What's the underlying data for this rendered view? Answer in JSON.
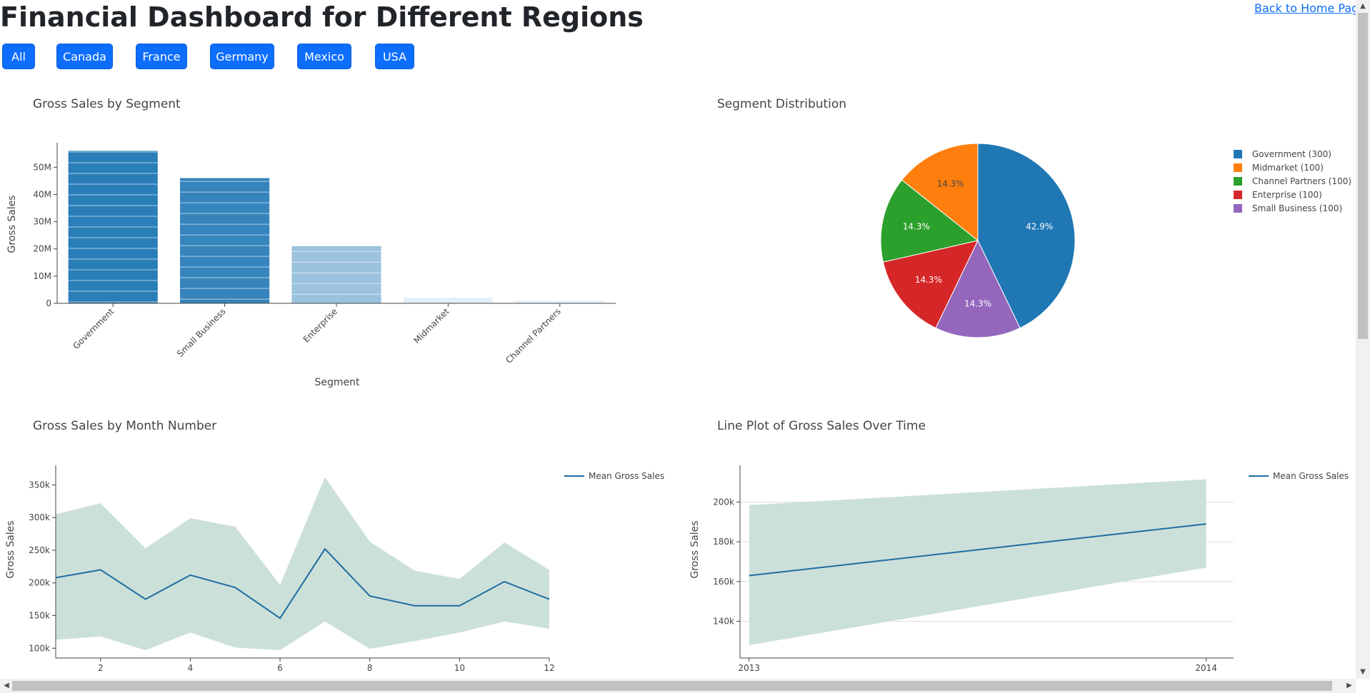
{
  "header": {
    "title": "Financial Dashboard for Different Regions",
    "home_link": "Back to Home Page"
  },
  "filters": [
    "All",
    "Canada",
    "France",
    "Germany",
    "Mexico",
    "USA"
  ],
  "colors": {
    "button": "#0d6efd",
    "bar": "#1f77b4",
    "band": "#cce0da",
    "line": "#1f6da0",
    "pie": [
      "#1f77b4",
      "#9467bd",
      "#d62728",
      "#2ca02c",
      "#ff7f0e"
    ]
  },
  "chart_data": [
    {
      "type": "bar",
      "title": "Gross Sales by Segment",
      "xlabel": "Segment",
      "ylabel": "Gross Sales",
      "categories": [
        "Government",
        "Small Business",
        "Enterprise",
        "Midmarket",
        "Channel Partners"
      ],
      "values": [
        56000000,
        46000000,
        21000000,
        2000000,
        1000000
      ],
      "ylim": [
        0,
        59000000
      ],
      "yticks": [
        0,
        10000000,
        20000000,
        30000000,
        40000000,
        50000000
      ],
      "ytick_labels": [
        "0",
        "10M",
        "20M",
        "30M",
        "40M",
        "50M"
      ]
    },
    {
      "type": "pie",
      "title": "Segment Distribution",
      "slices": [
        {
          "name": "Government (300)",
          "value": 300,
          "label": "42.9%"
        },
        {
          "name": "Small Business (100)",
          "value": 100,
          "label": "14.3%"
        },
        {
          "name": "Enterprise (100)",
          "value": 100,
          "label": "14.3%"
        },
        {
          "name": "Channel Partners (100)",
          "value": 100,
          "label": "14.3%"
        },
        {
          "name": "Midmarket (100)",
          "value": 100,
          "label": "14.3%"
        }
      ],
      "legend": [
        "Government (300)",
        "Midmarket (100)",
        "Channel Partners (100)",
        "Enterprise (100)",
        "Small Business (100)"
      ],
      "legend_placement": "right"
    },
    {
      "type": "area",
      "title": "Gross Sales by Month Number",
      "ylabel": "Gross Sales",
      "x": [
        1,
        2,
        3,
        4,
        5,
        6,
        7,
        8,
        9,
        10,
        11,
        12
      ],
      "series": [
        {
          "name": "Mean Gross Sales",
          "values": [
            208000,
            220000,
            175000,
            212000,
            193000,
            146000,
            252000,
            180000,
            165000,
            165000,
            202000,
            175000
          ]
        }
      ],
      "band_upper": [
        305000,
        322000,
        253000,
        299000,
        286000,
        197000,
        362000,
        263000,
        219000,
        206000,
        262000,
        220000
      ],
      "band_lower": [
        113000,
        118000,
        97000,
        124000,
        101000,
        97000,
        141000,
        99000,
        111000,
        124000,
        141000,
        130000
      ],
      "xlim": [
        1,
        12
      ],
      "ylim": [
        85000,
        380000
      ],
      "xticks": [
        2,
        4,
        6,
        8,
        10,
        12
      ],
      "xtick_labels": [
        "2",
        "4",
        "6",
        "8",
        "10",
        "12"
      ],
      "yticks": [
        100000,
        150000,
        200000,
        250000,
        300000,
        350000
      ],
      "ytick_labels": [
        "100k",
        "150k",
        "200k",
        "250k",
        "300k",
        "350k"
      ],
      "grid": false,
      "legend_placement": "top-right"
    },
    {
      "type": "area",
      "title": "Line Plot of Gross Sales Over Time",
      "ylabel": "Gross Sales",
      "x": [
        2013,
        2014
      ],
      "series": [
        {
          "name": "Mean Gross Sales",
          "values": [
            163000,
            189000
          ]
        }
      ],
      "band_upper": [
        198500,
        211500
      ],
      "band_lower": [
        128000,
        167000
      ],
      "xlim": [
        2012.98,
        2014.06
      ],
      "ylim": [
        121500,
        218500
      ],
      "xticks": [
        2013,
        2014
      ],
      "xtick_labels": [
        "2013",
        "2014"
      ],
      "yticks": [
        140000,
        160000,
        180000,
        200000
      ],
      "ytick_labels": [
        "140k",
        "160k",
        "180k",
        "200k"
      ],
      "grid": true,
      "legend_placement": "top-right"
    }
  ]
}
